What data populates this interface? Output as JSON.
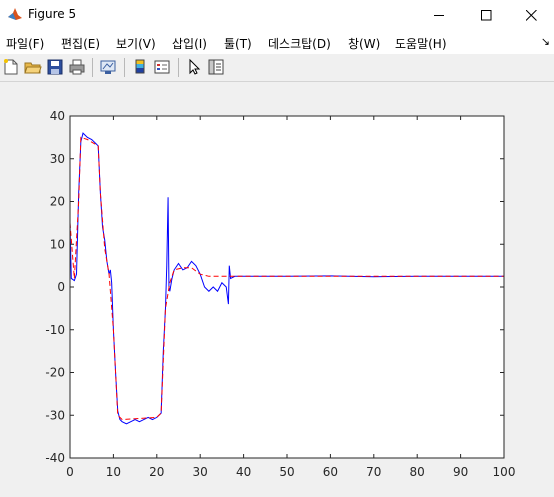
{
  "window": {
    "title": "Figure 5",
    "controls": [
      "minimize",
      "maximize",
      "close"
    ]
  },
  "menubar": {
    "items": [
      "파일(F)",
      "편집(E)",
      "보기(V)",
      "삽입(I)",
      "툴(T)",
      "데스크탑(D)",
      "창(W)",
      "도움말(H)"
    ],
    "dock_icon": "↘"
  },
  "toolbar": {
    "icons": [
      "new-figure-icon",
      "open-file-icon",
      "save-icon",
      "print-icon",
      "link-plot-icon",
      "insert-colorbar-icon",
      "insert-legend-icon",
      "edit-plot-icon",
      "property-inspector-icon"
    ]
  },
  "chart_data": {
    "type": "line",
    "title": "",
    "xlabel": "",
    "ylabel": "",
    "xlim": [
      0,
      100
    ],
    "ylim": [
      -40,
      40
    ],
    "xticks": [
      0,
      10,
      20,
      30,
      40,
      50,
      60,
      70,
      80,
      90,
      100
    ],
    "yticks": [
      -40,
      -30,
      -20,
      -10,
      0,
      10,
      20,
      30,
      40
    ],
    "grid": false,
    "legend": false,
    "series": [
      {
        "color": "#0000ff",
        "style": "solid",
        "points": [
          [
            0,
            15
          ],
          [
            0.3,
            2
          ],
          [
            1,
            1.5
          ],
          [
            1.5,
            3
          ],
          [
            2,
            22
          ],
          [
            2.5,
            34
          ],
          [
            3,
            36
          ],
          [
            3.5,
            35.5
          ],
          [
            4,
            35
          ],
          [
            5,
            34.5
          ],
          [
            6,
            33.5
          ],
          [
            6.5,
            33
          ],
          [
            7,
            22
          ],
          [
            7.5,
            14
          ],
          [
            8,
            11
          ],
          [
            8.5,
            6
          ],
          [
            9,
            3
          ],
          [
            9.3,
            4
          ],
          [
            9.6,
            1
          ],
          [
            10,
            -10
          ],
          [
            10.5,
            -20
          ],
          [
            11,
            -29
          ],
          [
            11.5,
            -31
          ],
          [
            12,
            -31.5
          ],
          [
            13,
            -32
          ],
          [
            14,
            -31.5
          ],
          [
            15,
            -31
          ],
          [
            16,
            -31.5
          ],
          [
            17,
            -31
          ],
          [
            18,
            -30.5
          ],
          [
            19,
            -31
          ],
          [
            20,
            -30.5
          ],
          [
            21,
            -29.5
          ],
          [
            21.5,
            -15
          ],
          [
            22,
            -5
          ],
          [
            22.3,
            5
          ],
          [
            22.6,
            21
          ],
          [
            22.8,
            0
          ],
          [
            23,
            -1
          ],
          [
            23.5,
            2
          ],
          [
            24,
            4
          ],
          [
            25,
            5.5
          ],
          [
            26,
            4
          ],
          [
            27,
            4.5
          ],
          [
            28,
            6
          ],
          [
            29,
            5
          ],
          [
            30,
            3
          ],
          [
            31,
            0
          ],
          [
            32,
            -1
          ],
          [
            33,
            0
          ],
          [
            34,
            -1
          ],
          [
            35,
            1
          ],
          [
            36,
            0
          ],
          [
            36.5,
            -4
          ],
          [
            36.7,
            5
          ],
          [
            37,
            2
          ],
          [
            38,
            2.5
          ],
          [
            40,
            2.5
          ],
          [
            50,
            2.5
          ],
          [
            60,
            2.6
          ],
          [
            70,
            2.4
          ],
          [
            80,
            2.5
          ],
          [
            90,
            2.5
          ],
          [
            100,
            2.5
          ]
        ]
      },
      {
        "color": "#ff0000",
        "style": "dashed",
        "points": [
          [
            0,
            15
          ],
          [
            1,
            2
          ],
          [
            2,
            20
          ],
          [
            2.5,
            35
          ],
          [
            4,
            34.5
          ],
          [
            6.5,
            33
          ],
          [
            7,
            22
          ],
          [
            8,
            9
          ],
          [
            9,
            3
          ],
          [
            10,
            -10
          ],
          [
            11,
            -30
          ],
          [
            12,
            -31
          ],
          [
            20,
            -30.5
          ],
          [
            21,
            -29.5
          ],
          [
            22,
            -5
          ],
          [
            23,
            1
          ],
          [
            24,
            4
          ],
          [
            26,
            4.5
          ],
          [
            28,
            4.5
          ],
          [
            30,
            3
          ],
          [
            32,
            2.5
          ],
          [
            36,
            2.5
          ],
          [
            40,
            2.5
          ],
          [
            100,
            2.5
          ]
        ]
      }
    ]
  }
}
